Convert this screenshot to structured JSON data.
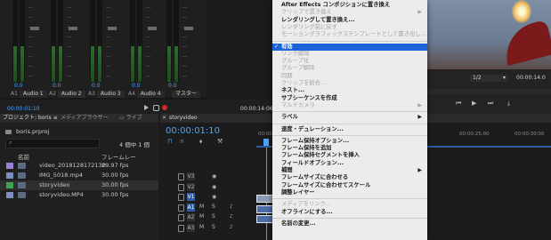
{
  "mixer": {
    "channels": [
      {
        "id": "A1",
        "name": "Audio 1",
        "value": "0.0"
      },
      {
        "id": "A2",
        "name": "Audio 2",
        "value": "0.0"
      },
      {
        "id": "A3",
        "name": "Audio 3",
        "value": "0.0"
      },
      {
        "id": "A4",
        "name": "Audio 4",
        "value": "0.0"
      }
    ],
    "master_label": "マスター",
    "master_value": "0.0",
    "timecode": "00:00:01:10",
    "timecode_right": "00:00:14:06"
  },
  "program": {
    "zoom": "1/2",
    "timecode": "00:00:14:0"
  },
  "project": {
    "tab_project": "プロジェクト: boris",
    "tab_media": "メディアブラウザー",
    "tab_library": "ライブ",
    "filename": "boris.prproj",
    "selection": "4 個中 1 個",
    "col_name": "名前",
    "col_fps": "フレームレー",
    "items": [
      {
        "name": "video_2018128172130",
        "fps": "29.97 fps",
        "color": "#9c7fd6"
      },
      {
        "name": "IMG_5018.mp4",
        "fps": "30.00 fps",
        "color": "#7c8ec0"
      },
      {
        "name": "storyvideo",
        "fps": "30.00 fps",
        "color": "#3fa34d"
      },
      {
        "name": "storyvideo.MP4",
        "fps": "30.00 fps",
        "color": "#7c8ec0"
      }
    ]
  },
  "timeline": {
    "tab": "storyvideo",
    "timecode": "00:00:01:10",
    "ruler": [
      "00:00",
      "00:00:25:00",
      "00:00:30:00"
    ],
    "tracks": [
      "V3",
      "V2",
      "V1",
      "A1",
      "A2",
      "A3"
    ],
    "track_toggle_labels": [
      "M",
      "S"
    ]
  },
  "menu": {
    "items": [
      {
        "label": "After Effects コンポジションに置き換え",
        "state": "bold"
      },
      {
        "label": "クリップで置き換え",
        "state": "dis",
        "arrow": true
      },
      {
        "label": "レンダリングして置き換え...",
        "state": "bold"
      },
      {
        "label": "レンダリング前に戻す",
        "state": "dis"
      },
      {
        "label": "モーショングラフィックステンプレートとして書き出し...",
        "state": "dis"
      },
      {
        "sep": true
      },
      {
        "label": "有効",
        "state": "sel",
        "check": true
      },
      {
        "label": "リンク解除",
        "state": "dis"
      },
      {
        "label": "グループ化",
        "state": "dis"
      },
      {
        "label": "グループ解除",
        "state": "dis"
      },
      {
        "label": "同期",
        "state": "dis"
      },
      {
        "label": "クリップを統合...",
        "state": "dis"
      },
      {
        "label": "ネスト...",
        "state": "bold"
      },
      {
        "label": "サブシーケンスを作成",
        "state": "bold"
      },
      {
        "label": "マルチカメラ",
        "state": "dis",
        "arrow": true
      },
      {
        "sep": true
      },
      {
        "label": "ラベル",
        "state": "bold",
        "arrow": true
      },
      {
        "sep": true
      },
      {
        "label": "速度・デュレーション...",
        "state": "bold"
      },
      {
        "sep": true
      },
      {
        "label": "フレーム保持オプション...",
        "state": "bold"
      },
      {
        "label": "フレーム保持を追加",
        "state": "bold"
      },
      {
        "label": "フレーム保持セグメントを挿入",
        "state": "bold"
      },
      {
        "label": "フィールドオプション...",
        "state": "bold"
      },
      {
        "label": "補間",
        "state": "bold",
        "arrow": true
      },
      {
        "label": "フレームサイズに合わせる",
        "state": "bold"
      },
      {
        "label": "フレームサイズに合わせてスケール",
        "state": "bold"
      },
      {
        "label": "調整レイヤー",
        "state": "bold"
      },
      {
        "sep": true
      },
      {
        "label": "メディアをリンク...",
        "state": "dis"
      },
      {
        "label": "オフラインにする...",
        "state": "bold"
      },
      {
        "sep": true
      },
      {
        "label": "名前の変更...",
        "state": "bold"
      }
    ]
  }
}
